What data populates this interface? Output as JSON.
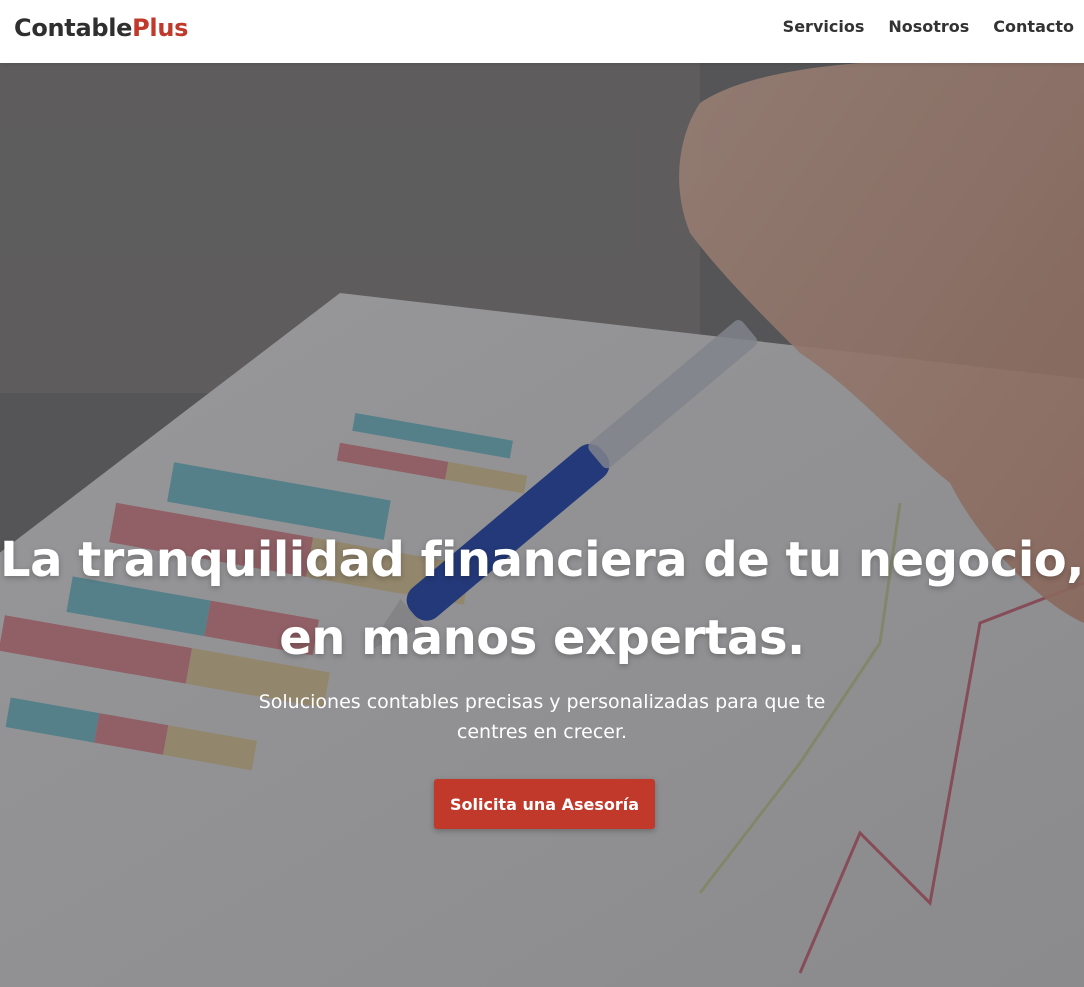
{
  "brand": {
    "part1": "Contable",
    "part2": "Plus",
    "accent": "#c0392b"
  },
  "nav": {
    "items": [
      {
        "label": "Servicios"
      },
      {
        "label": "Nosotros"
      },
      {
        "label": "Contacto"
      }
    ]
  },
  "hero": {
    "title_line1": "La tranquilidad financiera de tu negocio,",
    "title_line2": "en manos expertas.",
    "subtitle": "Soluciones contables precisas y personalizadas para que te centres en crecer.",
    "cta_label": "Solicita una Asesoría",
    "background": "photo-hand-pen-bar-chart"
  }
}
